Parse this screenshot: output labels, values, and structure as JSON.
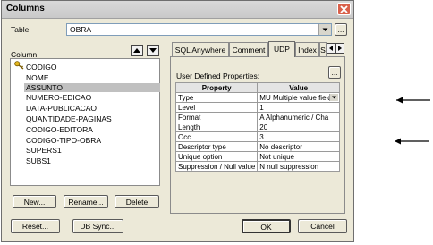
{
  "dialog": {
    "title": "Columns"
  },
  "table_field": {
    "label": "Table:",
    "value": "OBRA",
    "browse_label": "..."
  },
  "column_list": {
    "label": "Column",
    "items": [
      {
        "label": "CODIGO",
        "key": true
      },
      {
        "label": "NOME"
      },
      {
        "label": "ASSUNTO",
        "selected": true
      },
      {
        "label": "NUMERO-EDICAO"
      },
      {
        "label": "DATA-PUBLICACAO"
      },
      {
        "label": "QUANTIDADE-PAGINAS"
      },
      {
        "label": "CODIGO-EDITORA"
      },
      {
        "label": "CODIGO-TIPO-OBRA"
      },
      {
        "label": "SUPERS1"
      },
      {
        "label": "SUBS1"
      }
    ]
  },
  "list_buttons": {
    "new": "New...",
    "rename": "Rename...",
    "delete": "Delete"
  },
  "bottom_buttons": {
    "reset": "Reset...",
    "db_sync": "DB Sync...",
    "ok": "OK",
    "cancel": "Cancel"
  },
  "tabs": [
    {
      "label": "SQL Anywhere"
    },
    {
      "label": "Comment"
    },
    {
      "label": "UDP",
      "active": true
    },
    {
      "label": "Index"
    },
    {
      "label": "S"
    }
  ],
  "udp": {
    "label": "User Defined Properties:",
    "browse_label": "...",
    "headers": [
      "Property",
      "Value"
    ],
    "rows": [
      {
        "property": "Type",
        "value": "MU Multiple value field",
        "dropdown": true
      },
      {
        "property": "Level",
        "value": "1"
      },
      {
        "property": "Format",
        "value": "A Alphanumeric / Cha"
      },
      {
        "property": "Length",
        "value": "20"
      },
      {
        "property": "Occ",
        "value": "3"
      },
      {
        "property": "Descriptor type",
        "value": "No descriptor"
      },
      {
        "property": "Unique option",
        "value": "Not unique"
      },
      {
        "property": "Suppression / Null value",
        "value": "N null suppression"
      }
    ]
  },
  "icons": {
    "close": "close-icon",
    "key": "key-icon",
    "move_up": "arrow-up-icon",
    "move_down": "arrow-down-icon",
    "scroll_left": "chevron-left-icon",
    "scroll_right": "chevron-right-icon",
    "annotation": "left-arrow-icon"
  },
  "colors": {
    "selection": "#c0c0c0",
    "dialog_bg": "#ece9d8",
    "close_button": "#d9604a"
  }
}
